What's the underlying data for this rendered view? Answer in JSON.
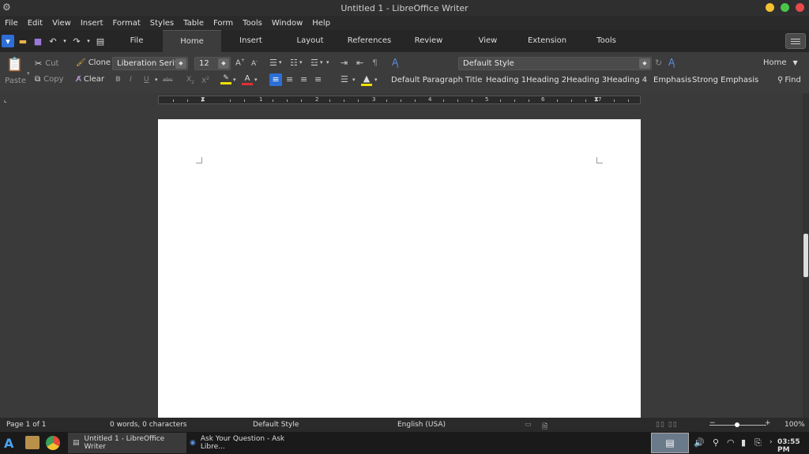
{
  "window": {
    "title": "Untitled 1 - LibreOffice Writer"
  },
  "menu": [
    "File",
    "Edit",
    "View",
    "Insert",
    "Format",
    "Styles",
    "Table",
    "Form",
    "Tools",
    "Window",
    "Help"
  ],
  "tabs": [
    "File",
    "Home",
    "Insert",
    "Layout",
    "References",
    "Review",
    "View",
    "Extension",
    "Tools"
  ],
  "active_tab": "Home",
  "toolbar": {
    "paste": "Paste",
    "cut": "Cut",
    "copy": "Copy",
    "clone": "Clone",
    "clear": "Clear",
    "font_name": "Liberation Serif",
    "font_size": "12",
    "para_style": "Default Style",
    "default_paragraph": "Default Paragraph",
    "styles": [
      "Title",
      "Heading 1",
      "Heading 2",
      "Heading 3",
      "Heading 4",
      "Emphasis",
      "Strong Emphasis"
    ],
    "home_dropdown": "Home",
    "find": "Find"
  },
  "ruler": {
    "numbers": [
      "1",
      "2",
      "3",
      "4",
      "5",
      "6",
      "7"
    ]
  },
  "status": {
    "page": "Page 1 of 1",
    "words": "0 words, 0 characters",
    "style": "Default Style",
    "language": "English (USA)",
    "zoom": "100%"
  },
  "taskbar": {
    "app1": "Untitled 1 - LibreOffice Writer",
    "app2": "Ask Your Question - Ask Libre...",
    "time": "03:55 PM"
  },
  "colors": {
    "accent": "#2d6fd6",
    "highlight": "#f0e000",
    "font_color": "#e03030"
  }
}
